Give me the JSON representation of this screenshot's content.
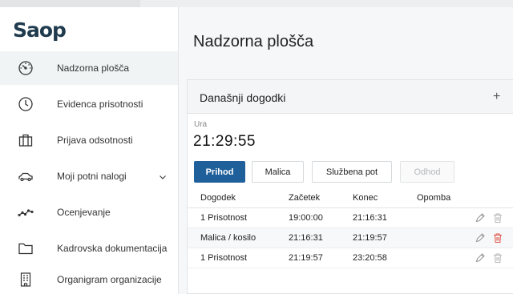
{
  "app": {
    "logo": "Saop"
  },
  "sidebar": {
    "items": [
      {
        "label": "Nadzorna plošča",
        "icon": "dashboard-gauge-icon",
        "active": true
      },
      {
        "label": "Evidenca prisotnosti",
        "icon": "clock-icon"
      },
      {
        "label": "Prijava odsotnosti",
        "icon": "briefcase-icon"
      },
      {
        "label": "Moji potni nalogi",
        "icon": "car-icon",
        "expandable": true
      },
      {
        "label": "Ocenjevanje",
        "icon": "trend-line-icon"
      },
      {
        "label": "Kadrovska dokumentacija",
        "icon": "folder-icon"
      },
      {
        "label": "Organigram organizacije",
        "icon": "building-icon"
      }
    ]
  },
  "main": {
    "title": "Nadzorna plošča",
    "card": {
      "title": "Današnji dogodki",
      "add_label": "+",
      "clock_label": "Ura",
      "clock_value": "21:29:55",
      "buttons": [
        {
          "label": "Prihod",
          "style": "primary"
        },
        {
          "label": "Malica",
          "style": "outline"
        },
        {
          "label": "Službena pot",
          "style": "outline"
        },
        {
          "label": "Odhod",
          "style": "disabled"
        }
      ],
      "columns": [
        "Dogodek",
        "Začetek",
        "Konec",
        "Opomba"
      ],
      "rows": [
        {
          "event": "1 Prisotnost",
          "start": "19:00:00",
          "end": "21:16:31",
          "note": "",
          "delete_color": "#b8b8b8"
        },
        {
          "event": "Malica / kosilo",
          "start": "21:16:31",
          "end": "21:19:57",
          "note": "",
          "delete_color": "#e05a4f"
        },
        {
          "event": "1 Prisotnost",
          "start": "21:19:57",
          "end": "23:20:58",
          "note": "",
          "delete_color": "#b8b8b8"
        }
      ]
    }
  },
  "colors": {
    "primary": "#1f5f9a",
    "logo": "#1f3b4d",
    "delete_active": "#e05a4f"
  }
}
